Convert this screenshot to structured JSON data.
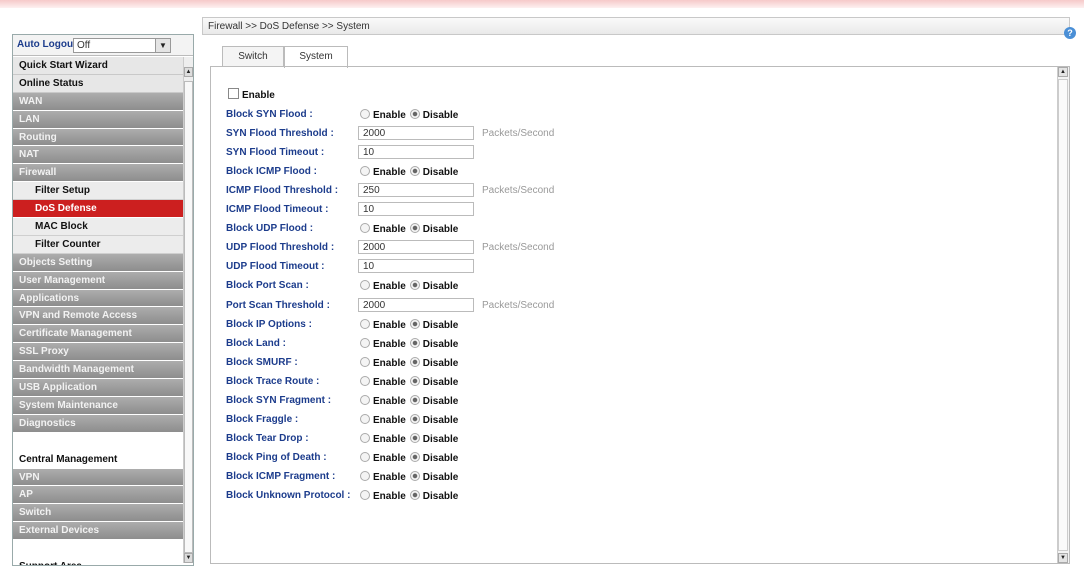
{
  "breadcrumb": "Firewall >> DoS Defense >> System",
  "sidebar": {
    "auto_logout_label": "Auto Logout :",
    "auto_logout_value": "Off",
    "items": [
      {
        "label": "Quick Start Wizard",
        "style": "light"
      },
      {
        "label": "Online Status",
        "style": "light"
      },
      {
        "label": "WAN",
        "style": "gray"
      },
      {
        "label": "LAN",
        "style": "gray"
      },
      {
        "label": "Routing",
        "style": "gray"
      },
      {
        "label": "NAT",
        "style": "gray"
      },
      {
        "label": "Firewall",
        "style": "gray"
      },
      {
        "label": "Filter Setup",
        "style": "sub"
      },
      {
        "label": "DoS Defense",
        "style": "active"
      },
      {
        "label": "MAC Block",
        "style": "sub"
      },
      {
        "label": "Filter Counter",
        "style": "sub"
      },
      {
        "label": "Objects Setting",
        "style": "gray"
      },
      {
        "label": "User Management",
        "style": "gray"
      },
      {
        "label": "Applications",
        "style": "gray"
      },
      {
        "label": "VPN and Remote Access",
        "style": "gray"
      },
      {
        "label": "Certificate Management",
        "style": "gray"
      },
      {
        "label": "SSL Proxy",
        "style": "gray"
      },
      {
        "label": "Bandwidth Management",
        "style": "gray"
      },
      {
        "label": "USB Application",
        "style": "gray"
      },
      {
        "label": "System Maintenance",
        "style": "gray"
      },
      {
        "label": "Diagnostics",
        "style": "gray"
      },
      {
        "label": "",
        "style": "blank"
      },
      {
        "label": "Central Management",
        "style": "plain"
      },
      {
        "label": "VPN",
        "style": "gray"
      },
      {
        "label": "AP",
        "style": "gray"
      },
      {
        "label": "Switch",
        "style": "gray"
      },
      {
        "label": "External Devices",
        "style": "gray"
      },
      {
        "label": "",
        "style": "blank"
      },
      {
        "label": "Support Area",
        "style": "plain"
      }
    ]
  },
  "tabs": [
    {
      "label": "Switch"
    },
    {
      "label": "System"
    }
  ],
  "enable_label": "Enable",
  "radio_enable": "Enable",
  "radio_disable": "Disable",
  "unit_label": "Packets/Second",
  "rows": [
    {
      "label": "Block SYN Flood :",
      "type": "radio",
      "value": "Disable"
    },
    {
      "label": "SYN Flood Threshold :",
      "type": "input",
      "value": "2000",
      "unit": true
    },
    {
      "label": "SYN Flood Timeout :",
      "type": "input",
      "value": "10"
    },
    {
      "label": "Block ICMP Flood :",
      "type": "radio",
      "value": "Disable"
    },
    {
      "label": "ICMP Flood Threshold :",
      "type": "input",
      "value": "250",
      "unit": true
    },
    {
      "label": "ICMP Flood Timeout :",
      "type": "input",
      "value": "10"
    },
    {
      "label": "Block UDP Flood :",
      "type": "radio",
      "value": "Disable"
    },
    {
      "label": "UDP Flood Threshold :",
      "type": "input",
      "value": "2000",
      "unit": true
    },
    {
      "label": "UDP Flood Timeout :",
      "type": "input",
      "value": "10"
    },
    {
      "label": "Block Port Scan :",
      "type": "radio",
      "value": "Disable"
    },
    {
      "label": "Port Scan Threshold :",
      "type": "input",
      "value": "2000",
      "unit": true
    },
    {
      "label": "Block IP Options :",
      "type": "radio",
      "value": "Disable"
    },
    {
      "label": "Block Land :",
      "type": "radio",
      "value": "Disable"
    },
    {
      "label": "Block SMURF :",
      "type": "radio",
      "value": "Disable"
    },
    {
      "label": "Block Trace Route :",
      "type": "radio",
      "value": "Disable"
    },
    {
      "label": "Block SYN Fragment :",
      "type": "radio",
      "value": "Disable"
    },
    {
      "label": "Block Fraggle :",
      "type": "radio",
      "value": "Disable"
    },
    {
      "label": "Block Tear Drop :",
      "type": "radio",
      "value": "Disable"
    },
    {
      "label": "Block Ping of Death :",
      "type": "radio",
      "value": "Disable"
    },
    {
      "label": "Block ICMP Fragment :",
      "type": "radio",
      "value": "Disable"
    },
    {
      "label": "Block Unknown Protocol :",
      "type": "radio",
      "value": "Disable"
    }
  ]
}
